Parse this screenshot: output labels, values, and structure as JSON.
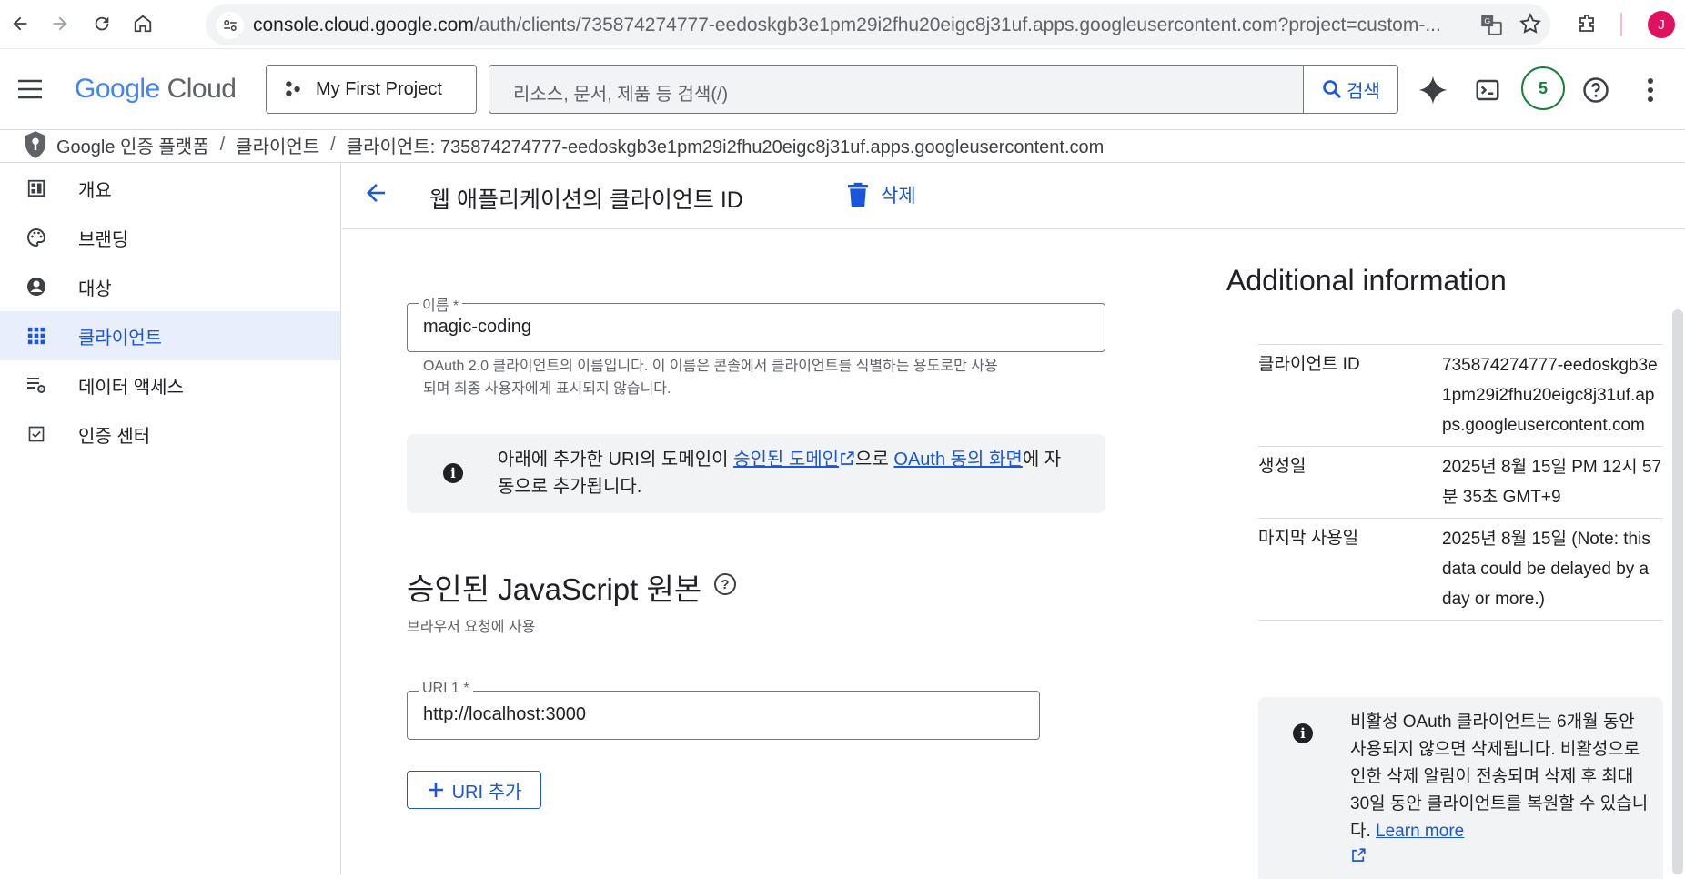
{
  "browser": {
    "url_host": "console.cloud.google.com",
    "url_rest": "/auth/clients/735874274777-eedoskgb3e1pm29i2fhu20eigc8j31uf.apps.googleusercontent.com?project=custom-...",
    "avatar_letter": "J"
  },
  "header": {
    "logo_google": "Google",
    "logo_cloud": "Cloud",
    "project": "My First Project",
    "search_placeholder": "리소스, 문서, 제품 등 검색(/)",
    "search_button": "검색",
    "notification_count": "5"
  },
  "breadcrumb": {
    "items": [
      "Google 인증 플랫폼",
      "클라이언트",
      "클라이언트: 735874274777-eedoskgb3e1pm29i2fhu20eigc8j31uf.apps.googleusercontent.com"
    ],
    "separator": "/"
  },
  "sidebar": {
    "items": [
      {
        "label": "개요",
        "icon": "dashboard-icon"
      },
      {
        "label": "브랜딩",
        "icon": "palette-icon"
      },
      {
        "label": "대상",
        "icon": "account-circle-icon"
      },
      {
        "label": "클라이언트",
        "icon": "apps-grid-icon",
        "active": true
      },
      {
        "label": "데이터 액세스",
        "icon": "data-settings-icon"
      },
      {
        "label": "인증 센터",
        "icon": "verified-check-icon"
      }
    ]
  },
  "titlebar": {
    "title": "웹 애플리케이션의 클라이언트 ID",
    "delete_label": "삭제"
  },
  "form": {
    "name_label": "이름 *",
    "name_value": "magic-coding",
    "name_hint_1": "OAuth 2.0 클라이언트의 이름입니다. 이 이름은 콘솔에서 클라이언트를 식별하는 용도로만 사용",
    "name_hint_2": "되며 최종 사용자에게 표시되지 않습니다.",
    "domain_info_pre": "아래에 추가한 URI의 도메인이 ",
    "domain_info_link1": "승인된 도메인",
    "domain_info_mid": "으로 ",
    "domain_info_link2": "OAuth 동의 화면",
    "domain_info_post": "에 자",
    "domain_info_line2": "동으로 추가됩니다.",
    "js_origins_title": "승인된 JavaScript 원본",
    "js_origins_subtitle": "브라우저 요청에 사용",
    "uri_label": "URI 1 *",
    "uri_value": "http://localhost:3000",
    "add_uri": "URI 추가"
  },
  "additional": {
    "title": "Additional information",
    "client_id_key": "클라이언트 ID",
    "client_id_value": "735874274777-eedoskgb3e1pm29i2fhu20eigc8j31uf.apps.googleusercontent.com",
    "created_key": "생성일",
    "created_value": "2025년 8월 15일 PM 12시 57분 35초 GMT+9",
    "last_used_key": "마지막 사용일",
    "last_used_value": "2025년 8월 15일 (Note: this data could be delayed by a day or more.)",
    "inactive_notice": "비활성 OAuth 클라이언트는 6개월 동안 사용되지 않으면 삭제됩니다. 비활성으로 인한 삭제 알림이 전송되며 삭제 후 최대 30일 동안 클라이언트를 복원할 수 있습니다. ",
    "learn_more": "Learn more"
  }
}
